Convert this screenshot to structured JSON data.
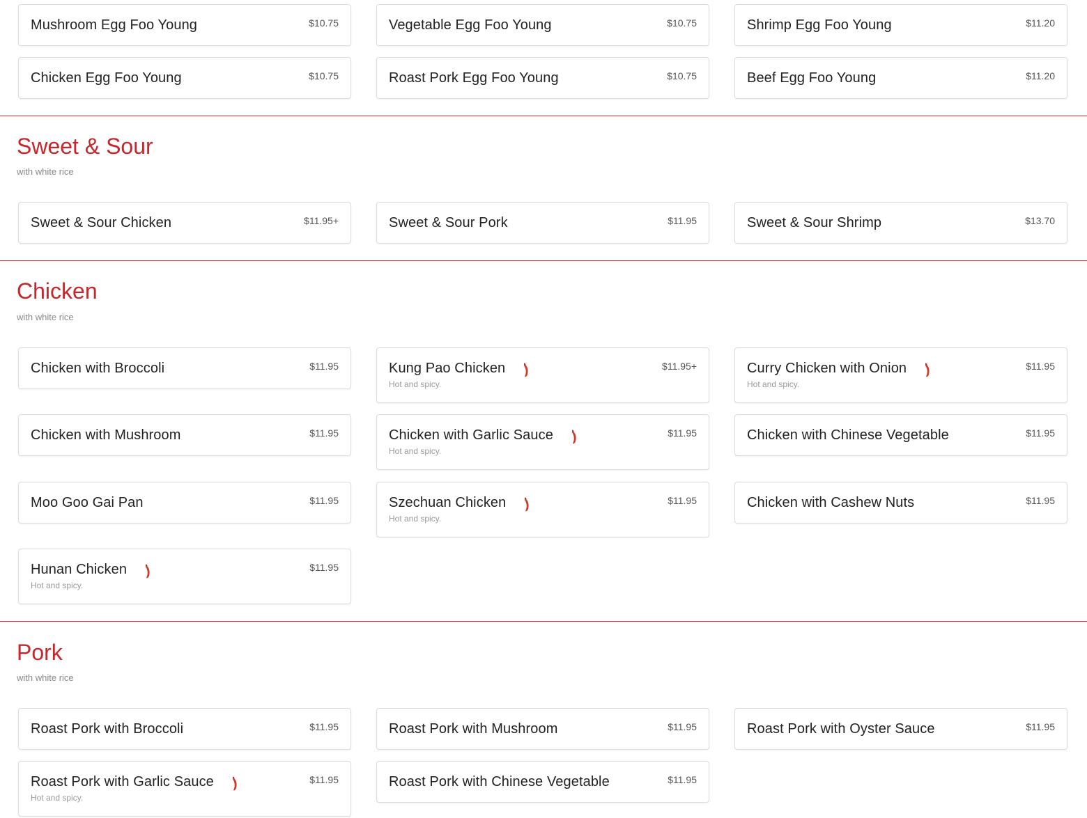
{
  "egg_foo_young": {
    "items": [
      {
        "name": "Mushroom Egg Foo Young",
        "price": "$10.75"
      },
      {
        "name": "Vegetable Egg Foo Young",
        "price": "$10.75"
      },
      {
        "name": "Shrimp Egg Foo Young",
        "price": "$11.20"
      },
      {
        "name": "Chicken Egg Foo Young",
        "price": "$10.75"
      },
      {
        "name": "Roast Pork Egg Foo Young",
        "price": "$10.75"
      },
      {
        "name": "Beef Egg Foo Young",
        "price": "$11.20"
      }
    ]
  },
  "sweet_sour": {
    "title": "Sweet & Sour",
    "subtitle": "with white rice",
    "items": [
      {
        "name": "Sweet & Sour Chicken",
        "price": "$11.95+"
      },
      {
        "name": "Sweet & Sour Pork",
        "price": "$11.95"
      },
      {
        "name": "Sweet & Sour Shrimp",
        "price": "$13.70"
      }
    ]
  },
  "chicken": {
    "title": "Chicken",
    "subtitle": "with white rice",
    "items": [
      {
        "name": "Chicken with Broccoli",
        "price": "$11.95"
      },
      {
        "name": "Kung Pao Chicken",
        "price": "$11.95+",
        "description": "Hot and spicy.",
        "icon": "chili-pepper-icon"
      },
      {
        "name": "Curry Chicken with Onion",
        "price": "$11.95",
        "description": "Hot and spicy.",
        "icon": "chili-pepper-icon"
      },
      {
        "name": "Chicken with Mushroom",
        "price": "$11.95"
      },
      {
        "name": "Chicken with Garlic Sauce",
        "price": "$11.95",
        "description": "Hot and spicy.",
        "icon": "chili-pepper-icon"
      },
      {
        "name": "Chicken with Chinese Vegetable",
        "price": "$11.95"
      },
      {
        "name": "Moo Goo Gai Pan",
        "price": "$11.95"
      },
      {
        "name": "Szechuan Chicken",
        "price": "$11.95",
        "description": "Hot and spicy.",
        "icon": "chili-pepper-icon"
      },
      {
        "name": "Chicken with Cashew Nuts",
        "price": "$11.95"
      },
      {
        "name": "Hunan Chicken",
        "price": "$11.95",
        "description": "Hot and spicy.",
        "icon": "chili-pepper-icon"
      }
    ]
  },
  "pork": {
    "title": "Pork",
    "subtitle": "with white rice",
    "items": [
      {
        "name": "Roast Pork with Broccoli",
        "price": "$11.95"
      },
      {
        "name": "Roast Pork with Mushroom",
        "price": "$11.95"
      },
      {
        "name": "Roast Pork with Oyster Sauce",
        "price": "$11.95"
      },
      {
        "name": "Roast Pork with Garlic Sauce",
        "price": "$11.95",
        "description": "Hot and spicy.",
        "icon": "chili-pepper-icon"
      },
      {
        "name": "Roast Pork with Chinese Vegetable",
        "price": "$11.95"
      }
    ]
  },
  "colors": {
    "accent": "#c8262a",
    "divider": "#c8322c",
    "pepper": "#d03a2a"
  }
}
